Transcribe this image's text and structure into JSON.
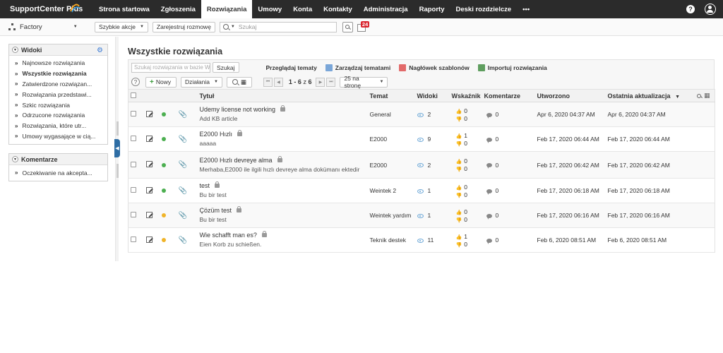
{
  "app": {
    "logo_text": "SupportCenter Plus",
    "nav": [
      "Strona startowa",
      "Zgłoszenia",
      "Rozwiązania",
      "Umowy",
      "Konta",
      "Kontakty",
      "Administracja",
      "Raporty",
      "Deski rozdzielcze"
    ],
    "nav_active_index": 2,
    "more_glyph": "•••",
    "help_glyph": "?"
  },
  "subbar": {
    "account": "Factory",
    "quick_actions": "Szybkie akcje",
    "log_call": "Zarejestruj rozmowę",
    "search_placeholder": "Szukaj",
    "reminder_count": "24"
  },
  "sidebar": {
    "views_title": "Widoki",
    "views": [
      "Najnowsze rozwiązania",
      "Wszystkie rozwiązania",
      "Zatwierdzone rozwiązan...",
      "Rozwiązania przedstawi...",
      "Szkic rozwiązania",
      "Odrzucone rozwiązania",
      "Rozwiązania, które utr...",
      "Umowy wygasające w cią..."
    ],
    "views_active_index": 1,
    "comments_title": "Komentarze",
    "comments": [
      "Oczekiwanie na akcepta..."
    ]
  },
  "main": {
    "title": "Wszystkie rozwiązania",
    "kb_search_placeholder": "Szukaj rozwiązania w bazie W",
    "kb_search_button": "Szukaj",
    "browse_topics": "Przeglądaj tematy",
    "manage_topics": "Zarządzaj tematami",
    "template_header": "Nagłówek szablonów",
    "import_solutions": "Importuj rozwiązania",
    "new_button": "Nowy",
    "actions_button": "Działania",
    "page_range": "1 - 6",
    "page_of": "z",
    "page_total": "6",
    "per_page": "25 na stronę"
  },
  "table": {
    "headers": {
      "title": "Tytuł",
      "topic": "Temat",
      "views": "Widoki",
      "rating": "Wskaźnik",
      "comments": "Komentarze",
      "created": "Utworzono",
      "updated": "Ostatnia aktualizacja"
    },
    "rows": [
      {
        "title": "Udemy license not working",
        "sub": "Add KB article",
        "topic": "General",
        "views": "2",
        "up": "0",
        "down": "0",
        "comments": "0",
        "created": "Apr 6, 2020 04:37 AM",
        "updated": "Apr 6, 2020 04:37 AM",
        "status": "#4caf50",
        "attach": false
      },
      {
        "title": "E2000 Hızlı",
        "sub": "aaaaa",
        "topic": "E2000",
        "views": "9",
        "up": "1",
        "down": "0",
        "comments": "0",
        "created": "Feb 17, 2020 06:44 AM",
        "updated": "Feb 17, 2020 06:44 AM",
        "status": "#4caf50",
        "attach": false
      },
      {
        "title": "E2000 Hızlı devreye alma",
        "sub": "Merhaba,E2000 ile ilgili hızlı devreye alma dokümanı ektedir",
        "topic": "E2000",
        "views": "2",
        "up": "0",
        "down": "0",
        "comments": "0",
        "created": "Feb 17, 2020 06:42 AM",
        "updated": "Feb 17, 2020 06:42 AM",
        "status": "#4caf50",
        "attach": true
      },
      {
        "title": "test",
        "sub": "Bu bir test",
        "topic": "Weintek 2",
        "views": "1",
        "up": "0",
        "down": "0",
        "comments": "0",
        "created": "Feb 17, 2020 06:18 AM",
        "updated": "Feb 17, 2020 06:18 AM",
        "status": "#4caf50",
        "attach": false
      },
      {
        "title": "Çözüm test",
        "sub": "Bu bir test",
        "topic": "Weintek yardım",
        "views": "1",
        "up": "0",
        "down": "0",
        "comments": "0",
        "created": "Feb 17, 2020 06:16 AM",
        "updated": "Feb 17, 2020 06:16 AM",
        "status": "#f0b429",
        "attach": false
      },
      {
        "title": "Wie schafft man es?",
        "sub": "Eien Korb zu schießen.",
        "topic": "Teknik destek",
        "views": "11",
        "up": "1",
        "down": "0",
        "comments": "0",
        "created": "Feb 6, 2020 08:51 AM",
        "updated": "Feb 6, 2020 08:51 AM",
        "status": "#f0b429",
        "attach": false
      }
    ]
  },
  "colors": {
    "topbar": "#2b2b2b",
    "status_approved": "#4caf50",
    "status_pending": "#f0b429",
    "badge": "#d9232d",
    "accent_blue": "#3a7bd5"
  }
}
